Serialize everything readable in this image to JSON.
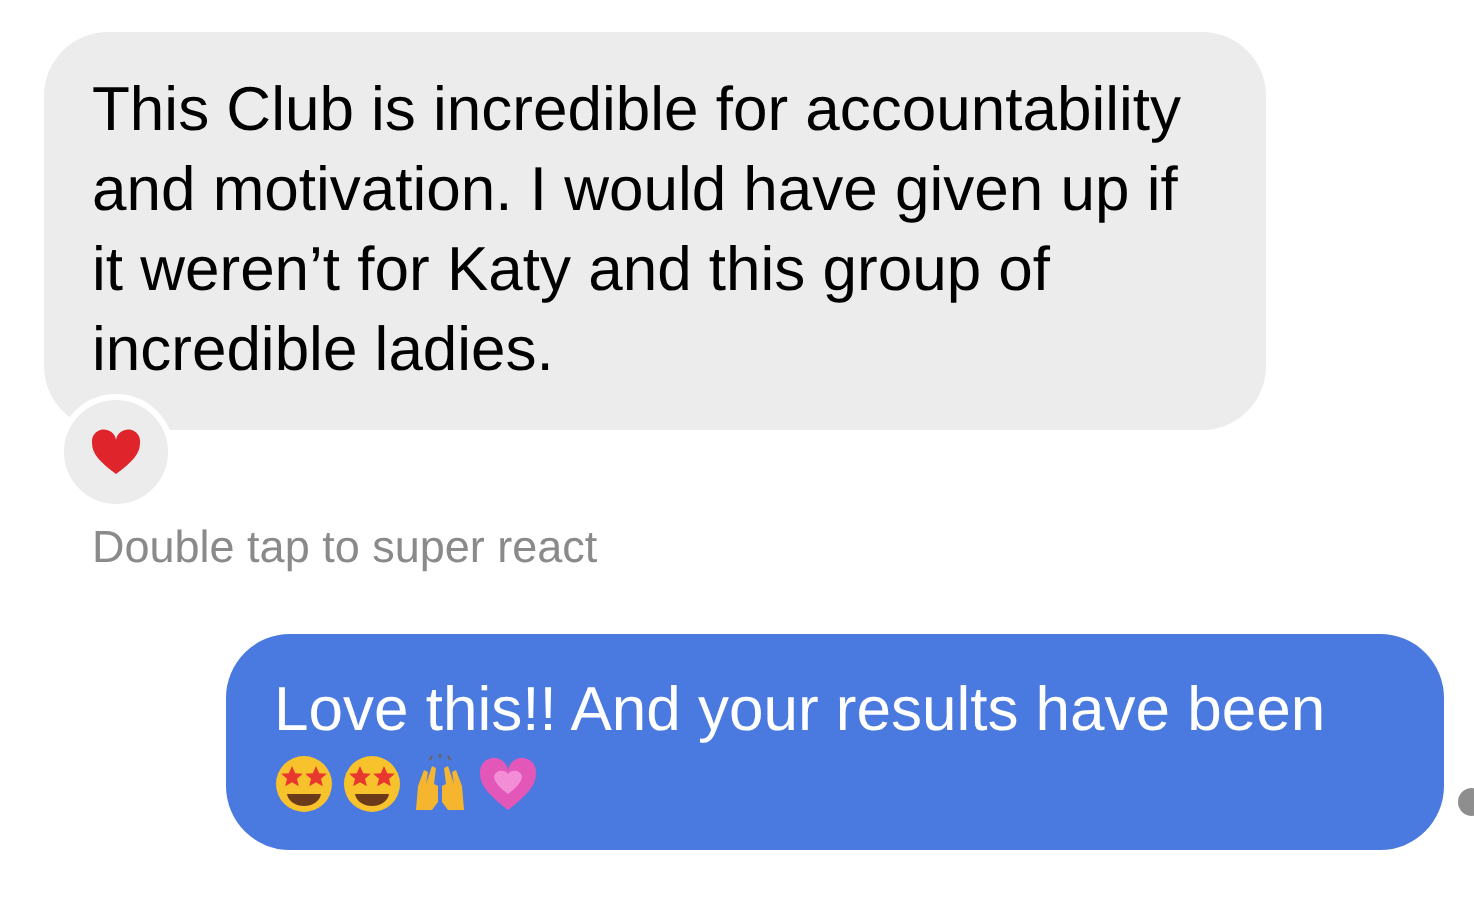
{
  "messages": [
    {
      "kind": "incoming",
      "text": "This Club is incredible for accountability and motivation. I would have given up if it weren’t for Katy and this group of incredible ladies.",
      "reaction": {
        "kind": "heart"
      },
      "hint": "Double tap to super react"
    },
    {
      "kind": "outgoing",
      "text": "Love this!! And your results have been",
      "emojis": [
        {
          "kind": "star-struck"
        },
        {
          "kind": "star-struck"
        },
        {
          "kind": "raised-hands"
        },
        {
          "kind": "pink-heart"
        }
      ]
    }
  ]
}
